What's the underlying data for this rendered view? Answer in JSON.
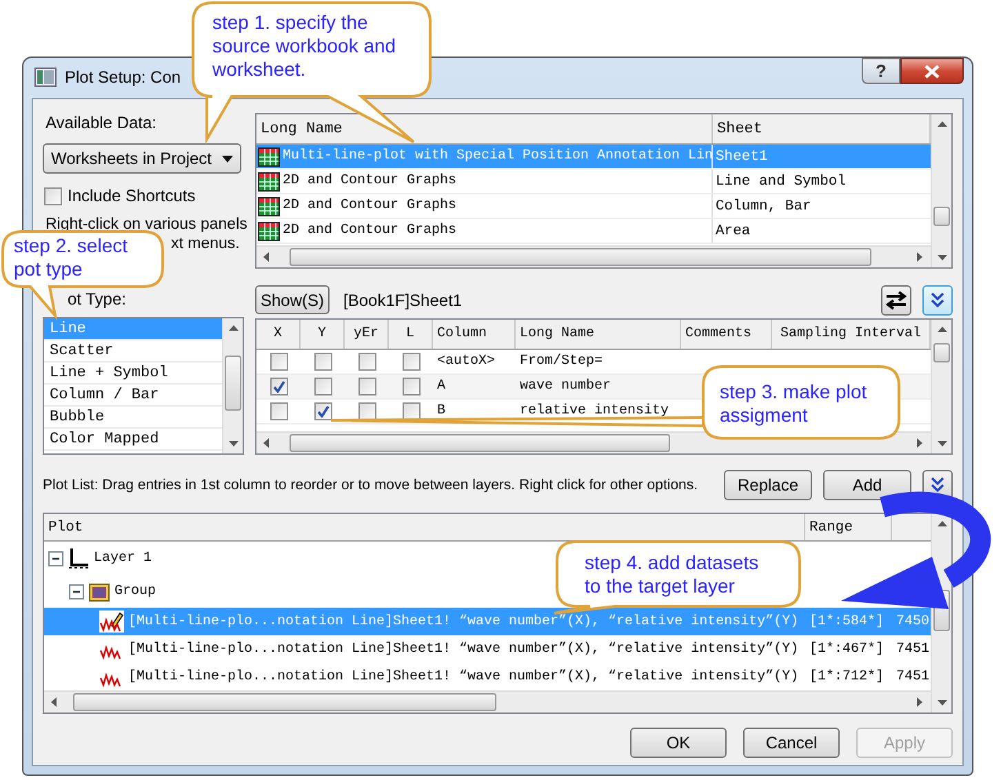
{
  "window": {
    "title": "Plot Setup: Con",
    "help_button": "?"
  },
  "available_data": {
    "label": "Available Data:",
    "value": "Worksheets in Project"
  },
  "include_shortcuts": {
    "label": "Include Shortcuts",
    "checked": false
  },
  "hint_lines": [
    "Right-click on various panels",
    "xt menus."
  ],
  "plot_type": {
    "label": "ot Type:",
    "items": [
      {
        "label": "Line",
        "selected": true
      },
      {
        "label": "Scatter",
        "selected": false
      },
      {
        "label": "Line + Symbol",
        "selected": false
      },
      {
        "label": "Column / Bar",
        "selected": false
      },
      {
        "label": "Bubble",
        "selected": false
      },
      {
        "label": "Color Mapped",
        "selected": false
      }
    ]
  },
  "worksheet_table": {
    "columns": [
      "Long Name",
      "Sheet"
    ],
    "rows": [
      {
        "long_name": "Multi-line-plot with Special Position Annotation Lin",
        "sheet": "Sheet1",
        "selected": true
      },
      {
        "long_name": "2D and Contour Graphs",
        "sheet": "Line and Symbol",
        "selected": false
      },
      {
        "long_name": "2D and Contour Graphs",
        "sheet": "Column, Bar",
        "selected": false
      },
      {
        "long_name": "2D and Contour Graphs",
        "sheet": "Area",
        "selected": false
      }
    ]
  },
  "show_button": "Show(S)",
  "sheet_path": "[Book1F]Sheet1",
  "column_table": {
    "columns": [
      "X",
      "Y",
      "yEr",
      "L",
      "Column",
      "Long Name",
      "Comments",
      "Sampling Interval"
    ],
    "rows": [
      {
        "x": false,
        "y": false,
        "yer": false,
        "l": false,
        "column": "<autoX>",
        "long_name": "From/Step="
      },
      {
        "x": true,
        "y": false,
        "yer": false,
        "l": false,
        "column": "A",
        "long_name": "wave number"
      },
      {
        "x": false,
        "y": true,
        "yer": false,
        "l": false,
        "column": "B",
        "long_name": "relative intensity"
      }
    ]
  },
  "plot_list": {
    "hint": "Plot List: Drag entries in 1st column to reorder or to move between layers. Right click for other options.",
    "buttons": [
      "Replace",
      "Add"
    ]
  },
  "plot_tree": {
    "columns": [
      "Plot",
      "Range"
    ],
    "items": [
      {
        "kind": "layer",
        "label": "Layer 1",
        "expanded": true,
        "children": [
          {
            "kind": "group",
            "label": "Group",
            "expanded": true,
            "children": [
              {
                "kind": "plot",
                "label": "[Multi-line-plo...notation Line]Sheet1! “wave number”(X), “relative intensity”(Y)",
                "range": "[1*:584*]",
                "column_3": "7450",
                "selected": true
              },
              {
                "kind": "plot",
                "label": "[Multi-line-plo...notation Line]Sheet1! “wave number”(X), “relative intensity”(Y)",
                "range": "[1*:467*]",
                "column_3": "7451",
                "selected": false
              },
              {
                "kind": "plot",
                "label": "[Multi-line-plo...notation Line]Sheet1! “wave number”(X), “relative intensity”(Y)",
                "range": "[1*:712*]",
                "column_3": "7451",
                "selected": false
              }
            ]
          }
        ]
      }
    ]
  },
  "dialog_buttons": [
    {
      "label": "OK",
      "disabled": false
    },
    {
      "label": "Cancel",
      "disabled": false
    },
    {
      "label": "Apply",
      "disabled": true
    }
  ],
  "callouts": [
    {
      "text": "step 1. specify the source workbook and worksheet."
    },
    {
      "text": "step 2. select pot type"
    },
    {
      "text": "step 3. make plot assigment"
    },
    {
      "text": "step 4. add datasets to the target layer"
    }
  ]
}
